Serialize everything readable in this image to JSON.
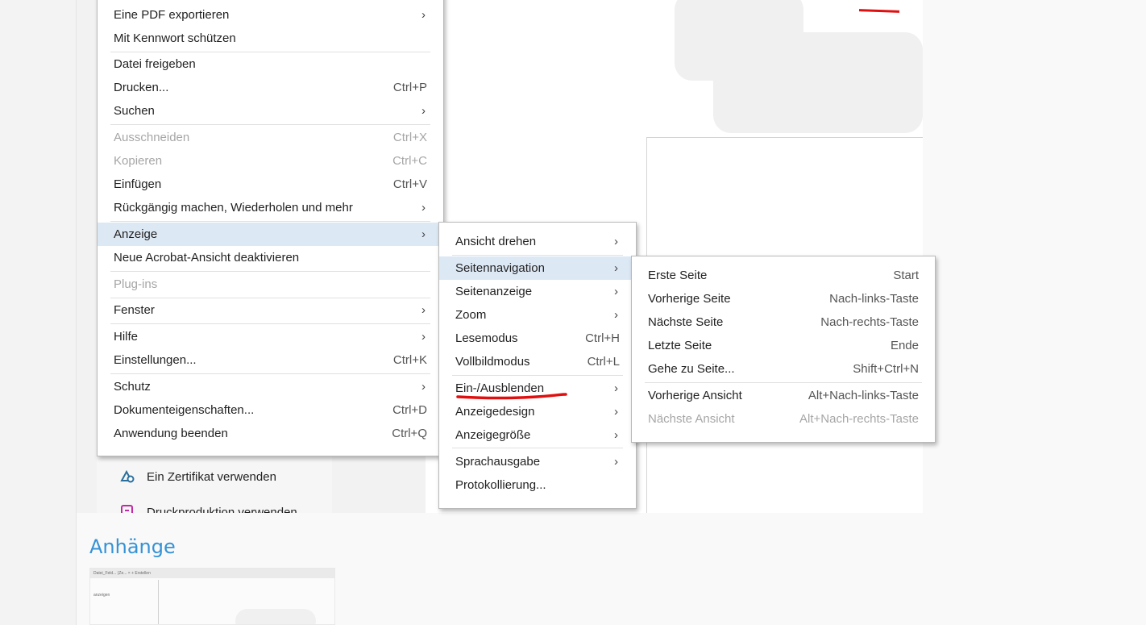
{
  "main_menu": {
    "items": [
      {
        "label": "Eine PDF exportieren",
        "shortcut": "",
        "submenu": true,
        "disabled": false,
        "highlighted": false
      },
      {
        "label": "Mit Kennwort schützen",
        "shortcut": "",
        "submenu": false,
        "disabled": false,
        "highlighted": false
      },
      {
        "label": "Datei freigeben",
        "shortcut": "",
        "submenu": false,
        "disabled": false,
        "highlighted": false
      },
      {
        "label": "Drucken...",
        "shortcut": "Ctrl+P",
        "submenu": false,
        "disabled": false,
        "highlighted": false
      },
      {
        "label": "Suchen",
        "shortcut": "",
        "submenu": true,
        "disabled": false,
        "highlighted": false
      },
      {
        "label": "Ausschneiden",
        "shortcut": "Ctrl+X",
        "submenu": false,
        "disabled": true,
        "highlighted": false
      },
      {
        "label": "Kopieren",
        "shortcut": "Ctrl+C",
        "submenu": false,
        "disabled": true,
        "highlighted": false
      },
      {
        "label": "Einfügen",
        "shortcut": "Ctrl+V",
        "submenu": false,
        "disabled": false,
        "highlighted": false
      },
      {
        "label": "Rückgängig machen, Wiederholen und mehr",
        "shortcut": "",
        "submenu": true,
        "disabled": false,
        "highlighted": false
      },
      {
        "label": "Anzeige",
        "shortcut": "",
        "submenu": true,
        "disabled": false,
        "highlighted": true
      },
      {
        "label": "Neue Acrobat-Ansicht deaktivieren",
        "shortcut": "",
        "submenu": false,
        "disabled": false,
        "highlighted": false
      },
      {
        "label": "Plug-ins",
        "shortcut": "",
        "submenu": false,
        "disabled": true,
        "highlighted": false
      },
      {
        "label": "Fenster",
        "shortcut": "",
        "submenu": true,
        "disabled": false,
        "highlighted": false
      },
      {
        "label": "Hilfe",
        "shortcut": "",
        "submenu": true,
        "disabled": false,
        "highlighted": false
      },
      {
        "label": "Einstellungen...",
        "shortcut": "Ctrl+K",
        "submenu": false,
        "disabled": false,
        "highlighted": false
      },
      {
        "label": "Schutz",
        "shortcut": "",
        "submenu": true,
        "disabled": false,
        "highlighted": false
      },
      {
        "label": "Dokumenteigenschaften...",
        "shortcut": "Ctrl+D",
        "submenu": false,
        "disabled": false,
        "highlighted": false
      },
      {
        "label": "Anwendung beenden",
        "shortcut": "Ctrl+Q",
        "submenu": false,
        "disabled": false,
        "highlighted": false
      }
    ]
  },
  "view_menu": {
    "items": [
      {
        "label": "Ansicht drehen",
        "shortcut": "",
        "submenu": true,
        "disabled": false,
        "highlighted": false
      },
      {
        "label": "Seitennavigation",
        "shortcut": "",
        "submenu": true,
        "disabled": false,
        "highlighted": true
      },
      {
        "label": "Seitenanzeige",
        "shortcut": "",
        "submenu": true,
        "disabled": false,
        "highlighted": false
      },
      {
        "label": "Zoom",
        "shortcut": "",
        "submenu": true,
        "disabled": false,
        "highlighted": false
      },
      {
        "label": "Lesemodus",
        "shortcut": "Ctrl+H",
        "submenu": false,
        "disabled": false,
        "highlighted": false
      },
      {
        "label": "Vollbildmodus",
        "shortcut": "Ctrl+L",
        "submenu": false,
        "disabled": false,
        "highlighted": false
      },
      {
        "label": "Ein-/Ausblenden",
        "shortcut": "",
        "submenu": true,
        "disabled": false,
        "highlighted": false
      },
      {
        "label": "Anzeigedesign",
        "shortcut": "",
        "submenu": true,
        "disabled": false,
        "highlighted": false
      },
      {
        "label": "Anzeigegröße",
        "shortcut": "",
        "submenu": true,
        "disabled": false,
        "highlighted": false
      },
      {
        "label": "Sprachausgabe",
        "shortcut": "",
        "submenu": true,
        "disabled": false,
        "highlighted": false
      },
      {
        "label": "Protokollierung...",
        "shortcut": "",
        "submenu": false,
        "disabled": false,
        "highlighted": false
      }
    ]
  },
  "page_nav_menu": {
    "items": [
      {
        "label": "Erste Seite",
        "shortcut": "Start",
        "submenu": false,
        "disabled": false,
        "highlighted": false
      },
      {
        "label": "Vorherige Seite",
        "shortcut": "Nach-links-Taste",
        "submenu": false,
        "disabled": false,
        "highlighted": false
      },
      {
        "label": "Nächste Seite",
        "shortcut": "Nach-rechts-Taste",
        "submenu": false,
        "disabled": false,
        "highlighted": false
      },
      {
        "label": "Letzte Seite",
        "shortcut": "Ende",
        "submenu": false,
        "disabled": false,
        "highlighted": false
      },
      {
        "label": "Gehe zu Seite...",
        "shortcut": "Shift+Ctrl+N",
        "submenu": false,
        "disabled": false,
        "highlighted": false
      },
      {
        "label": "Vorherige Ansicht",
        "shortcut": "Alt+Nach-links-Taste",
        "submenu": false,
        "disabled": false,
        "highlighted": false
      },
      {
        "label": "Nächste Ansicht",
        "shortcut": "Alt+Nach-rechts-Taste",
        "submenu": false,
        "disabled": true,
        "highlighted": false
      }
    ]
  },
  "tools": {
    "certificate_label": "Ein Zertifikat verwenden",
    "print_production_label": "Druckproduktion verwenden"
  },
  "attachments": {
    "heading": "Anhänge",
    "thumbnail_tab_label": "Datei_Feld... (Ze...   ×    + Erstellen",
    "thumbnail_row_label": "anzeigen"
  },
  "colors": {
    "menu_highlight": "#dde8f5",
    "annotation_red": "#e01010",
    "link_blue": "#3592d6"
  },
  "icons": {
    "submenu_arrow": "›"
  }
}
